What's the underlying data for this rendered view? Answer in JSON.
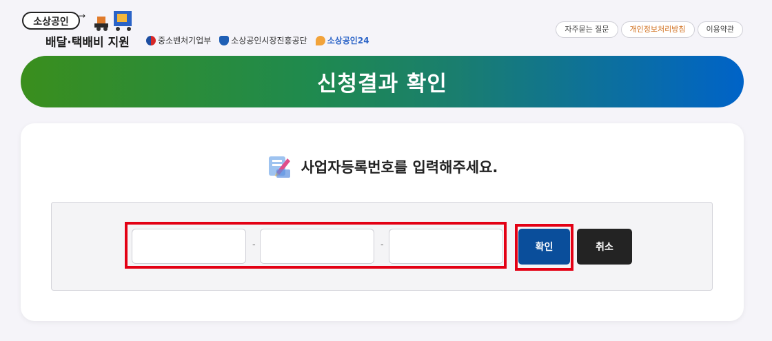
{
  "header": {
    "logo_top": "소상공인",
    "logo_bottom": "배달·택배비 지원",
    "partners": [
      {
        "label": "중소벤처기업부",
        "icon": "ministry-emblem-icon"
      },
      {
        "label": "소상공인시장진흥공단",
        "icon": "semas-emblem-icon"
      },
      {
        "label": "소상공인24",
        "icon": "sbiz24-logo-icon"
      }
    ],
    "nav": [
      {
        "label": "자주묻는 질문"
      },
      {
        "label": "개인정보처리방침"
      },
      {
        "label": "이용약관"
      }
    ]
  },
  "banner": {
    "title": "신청결과 확인"
  },
  "form": {
    "prompt": "사업자등록번호를 입력해주세요.",
    "separator": "-",
    "fields": [
      {
        "value": ""
      },
      {
        "value": ""
      },
      {
        "value": ""
      }
    ],
    "confirm_label": "확인",
    "cancel_label": "취소"
  },
  "colors": {
    "banner_start": "#3a8e1d",
    "banner_end": "#0063c8",
    "confirm_button": "#0a4e9b",
    "cancel_button": "#232323",
    "highlight_frame": "#e30014"
  }
}
